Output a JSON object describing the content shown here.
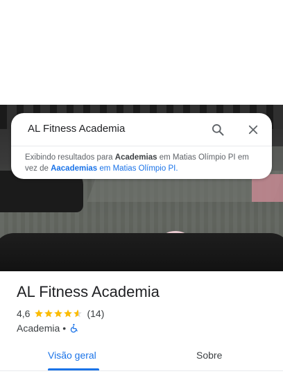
{
  "search": {
    "query": "AL Fitness Academia",
    "notice_prefix": "Exibindo resultados para ",
    "notice_corrected": "Academias",
    "notice_middle": " em Matias Olímpio PI em vez de ",
    "notice_original": "Aacademias",
    "notice_original_suffix": " em Matias Olímpio PI."
  },
  "place": {
    "name": "AL Fitness Academia",
    "rating": "4,6",
    "rating_value": 4.6,
    "review_count": "(14)",
    "category": "Academia",
    "separator": "•"
  },
  "tabs": [
    {
      "label": "Visão geral",
      "selected": true
    },
    {
      "label": "Sobre",
      "selected": false
    }
  ],
  "colors": {
    "accent": "#1a73e8",
    "star": "#fbbc04",
    "text": "#202124"
  },
  "icons": [
    "search-icon",
    "close-icon",
    "star-icon",
    "wheelchair-icon"
  ]
}
